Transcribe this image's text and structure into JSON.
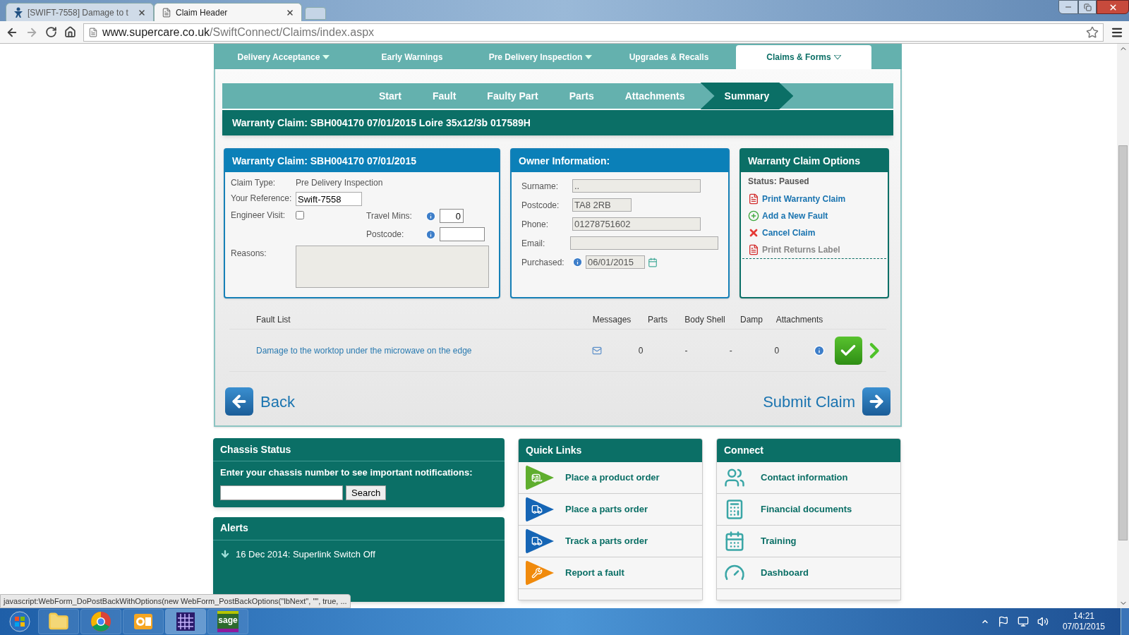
{
  "browser": {
    "tabs": [
      {
        "title": "[SWIFT-7558] Damage to t",
        "selected": false
      },
      {
        "title": "Claim Header",
        "selected": true
      }
    ],
    "url": {
      "host": "www.supercare.co.uk",
      "path": "/SwiftConnect/Claims/index.aspx"
    }
  },
  "nav": [
    {
      "label": "Delivery Acceptance",
      "dropdown": true,
      "selected": false
    },
    {
      "label": "Early Warnings",
      "dropdown": false,
      "selected": false
    },
    {
      "label": "Pre Delivery Inspection",
      "dropdown": true,
      "selected": false
    },
    {
      "label": "Upgrades & Recalls",
      "dropdown": false,
      "selected": false
    },
    {
      "label": "Claims & Forms",
      "dropdown": true,
      "selected": true
    }
  ],
  "steps": [
    {
      "label": "Start",
      "selected": false
    },
    {
      "label": "Fault",
      "selected": false
    },
    {
      "label": "Faulty Part",
      "selected": false
    },
    {
      "label": "Parts",
      "selected": false
    },
    {
      "label": "Attachments",
      "selected": false
    },
    {
      "label": "Summary",
      "selected": true
    }
  ],
  "claim_title": "Warranty Claim: SBH004170 07/01/2015 Loire 35x12/3b 017589H",
  "claim_card": {
    "title": "Warranty Claim: SBH004170 07/01/2015",
    "claim_type": {
      "label": "Claim Type:",
      "value": "Pre Delivery Inspection"
    },
    "reference": {
      "label": "Your Reference:",
      "value": "Swift-7558"
    },
    "engineer_visit": {
      "label": "Engineer Visit:",
      "checked": false
    },
    "travel_mins": {
      "label": "Travel Mins:",
      "value": "0"
    },
    "postcode": {
      "label": "Postcode:"
    },
    "reasons": {
      "label": "Reasons:"
    }
  },
  "owner_card": {
    "title": "Owner Information:",
    "fields": [
      {
        "kind": "text",
        "label": "Surname:",
        "value": ".."
      },
      {
        "kind": "short",
        "label": "Postcode:",
        "value": "TA8 2RB"
      },
      {
        "kind": "text",
        "label": "Phone:",
        "value": "01278751602"
      },
      {
        "kind": "wide",
        "label": "Email:"
      },
      {
        "kind": "date",
        "label": "Purchased:",
        "value": "06/01/2015"
      }
    ]
  },
  "options_card": {
    "title": "Warranty Claim Options",
    "status": "Status: Paused",
    "links": [
      {
        "kind": "pdf",
        "label": "Print Warranty Claim",
        "disabled": false
      },
      {
        "kind": "add",
        "label": "Add a New Fault",
        "disabled": false
      },
      {
        "kind": "cancel",
        "label": "Cancel Claim",
        "disabled": false
      },
      {
        "kind": "pdf",
        "label": "Print Returns Label",
        "disabled": true
      }
    ]
  },
  "faults": {
    "columns": [
      "Fault List",
      "Messages",
      "Parts",
      "Body Shell",
      "Damp",
      "Attachments"
    ],
    "rows": [
      {
        "description": "Damage to the worktop under the microwave on the edge",
        "parts": "0",
        "body_shell": "-",
        "damp": "-",
        "attachments": "0"
      }
    ]
  },
  "back": "Back",
  "submit": "Submit Claim",
  "chassis": {
    "title": "Chassis Status",
    "prompt": "Enter your chassis number to see important notifications:",
    "button": "Search"
  },
  "alerts": {
    "title": "Alerts",
    "items": [
      "16 Dec 2014: Superlink Switch Off"
    ]
  },
  "quick_links": {
    "title": "Quick Links",
    "items": [
      {
        "label": "Place a product order",
        "kind": "caravan",
        "color": "#5fae2e"
      },
      {
        "label": "Place a parts order",
        "kind": "truck",
        "color": "#1565b5"
      },
      {
        "label": "Track a parts order",
        "kind": "truck",
        "color": "#1565b5"
      },
      {
        "label": "Report a fault",
        "kind": "tools",
        "color": "#f08a0c"
      }
    ]
  },
  "connect": {
    "title": "Connect",
    "items": [
      {
        "label": "Contact information",
        "kind": "people"
      },
      {
        "label": "Financial documents",
        "kind": "calculator"
      },
      {
        "label": "Training",
        "kind": "calendar"
      },
      {
        "label": "Dashboard",
        "kind": "gauge"
      }
    ]
  },
  "status_text": "javascript:WebForm_DoPostBackWithOptions(new WebForm_PostBackOptions(\"lbNext\", \"\", true, ...",
  "taskbar": {
    "apps": [
      {
        "kind": "explorer"
      },
      {
        "kind": "chrome"
      },
      {
        "kind": "outlook"
      },
      {
        "kind": "grid"
      },
      {
        "kind": "sage",
        "text": "sage"
      }
    ],
    "time": "14:21",
    "date": "07/01/2015"
  }
}
